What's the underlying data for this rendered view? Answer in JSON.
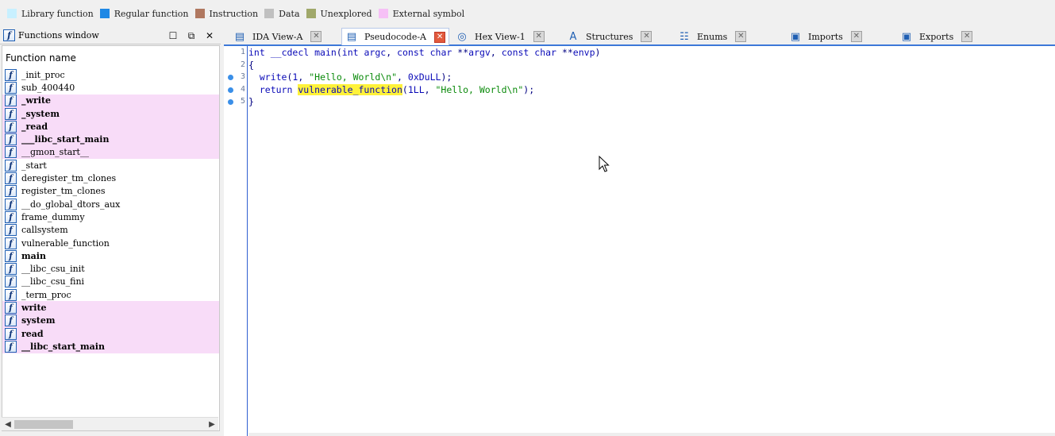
{
  "legend": [
    {
      "label": "Library function",
      "color": "#c8f0ff"
    },
    {
      "label": "Regular function",
      "color": "#1e88e5"
    },
    {
      "label": "Instruction",
      "color": "#b07860"
    },
    {
      "label": "Data",
      "color": "#c0c0c0"
    },
    {
      "label": "Unexplored",
      "color": "#a0a86a"
    },
    {
      "label": "External symbol",
      "color": "#f6c0f6"
    }
  ],
  "functions_window": {
    "title": "Functions window",
    "column_header": "Function name",
    "functions": [
      {
        "name": "_init_proc",
        "external": false,
        "bold": false
      },
      {
        "name": "sub_400440",
        "external": false,
        "bold": false
      },
      {
        "name": "_write",
        "external": true,
        "bold": true
      },
      {
        "name": "_system",
        "external": true,
        "bold": true
      },
      {
        "name": "_read",
        "external": true,
        "bold": true
      },
      {
        "name": "___libc_start_main",
        "external": true,
        "bold": true
      },
      {
        "name": "__gmon_start__",
        "external": true,
        "bold": false
      },
      {
        "name": "_start",
        "external": false,
        "bold": false
      },
      {
        "name": "deregister_tm_clones",
        "external": false,
        "bold": false
      },
      {
        "name": "register_tm_clones",
        "external": false,
        "bold": false
      },
      {
        "name": "__do_global_dtors_aux",
        "external": false,
        "bold": false
      },
      {
        "name": "frame_dummy",
        "external": false,
        "bold": false
      },
      {
        "name": "callsystem",
        "external": false,
        "bold": false
      },
      {
        "name": "vulnerable_function",
        "external": false,
        "bold": false
      },
      {
        "name": "main",
        "external": false,
        "bold": true
      },
      {
        "name": "__libc_csu_init",
        "external": false,
        "bold": false
      },
      {
        "name": "__libc_csu_fini",
        "external": false,
        "bold": false
      },
      {
        "name": "_term_proc",
        "external": false,
        "bold": false
      },
      {
        "name": "write",
        "external": true,
        "bold": true
      },
      {
        "name": "system",
        "external": true,
        "bold": true
      },
      {
        "name": "read",
        "external": true,
        "bold": true
      },
      {
        "name": "__libc_start_main",
        "external": true,
        "bold": true
      }
    ]
  },
  "tabs": [
    {
      "label": "IDA View-A",
      "icon": "ida-view-icon",
      "active": false
    },
    {
      "label": "Pseudocode-A",
      "icon": "pseudocode-icon",
      "active": true
    },
    {
      "label": "Hex View-1",
      "icon": "hex-view-icon",
      "active": false
    },
    {
      "label": "Structures",
      "icon": "structures-icon",
      "active": false
    },
    {
      "label": "Enums",
      "icon": "enums-icon",
      "active": false
    },
    {
      "label": "Imports",
      "icon": "imports-icon",
      "active": false
    },
    {
      "label": "Exports",
      "icon": "exports-icon",
      "active": false
    }
  ],
  "code": {
    "lines": [
      {
        "num": "1",
        "dot": false,
        "text": "int __cdecl main(int argc, const char **argv, const char **envp)"
      },
      {
        "num": "2",
        "dot": false,
        "text": "{"
      },
      {
        "num": "3",
        "dot": true,
        "text": "  write(1, \"Hello, World\\n\", 0xDuLL);"
      },
      {
        "num": "4",
        "dot": true,
        "text": "  return vulnerable_function(1LL, \"Hello, World\\n\");"
      },
      {
        "num": "5",
        "dot": true,
        "text": "}"
      }
    ],
    "highlighted_identifier": "vulnerable_function"
  }
}
